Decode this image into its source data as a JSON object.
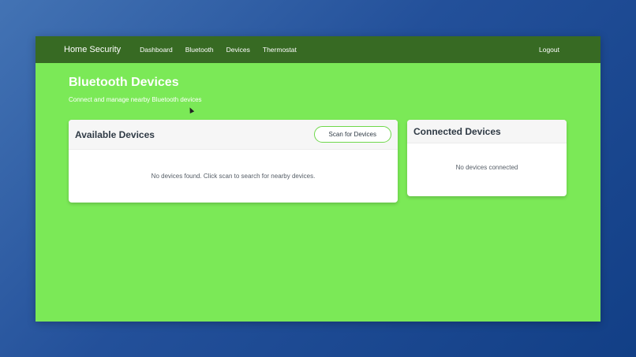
{
  "navbar": {
    "brand": "Home Security",
    "links": [
      "Dashboard",
      "Bluetooth",
      "Devices",
      "Thermostat"
    ],
    "logout": "Logout"
  },
  "header": {
    "title": "Bluetooth Devices",
    "subtitle": "Connect and manage nearby Bluetooth devices"
  },
  "available_devices": {
    "title": "Available Devices",
    "scan_button": "Scan for Devices",
    "empty_message": "No devices found. Click scan to search for nearby devices."
  },
  "connected_devices": {
    "title": "Connected Devices",
    "empty_message": "No devices connected"
  },
  "colors": {
    "navbar": "#376a23",
    "page_background": "#7be957",
    "accent": "#6fd84b"
  }
}
